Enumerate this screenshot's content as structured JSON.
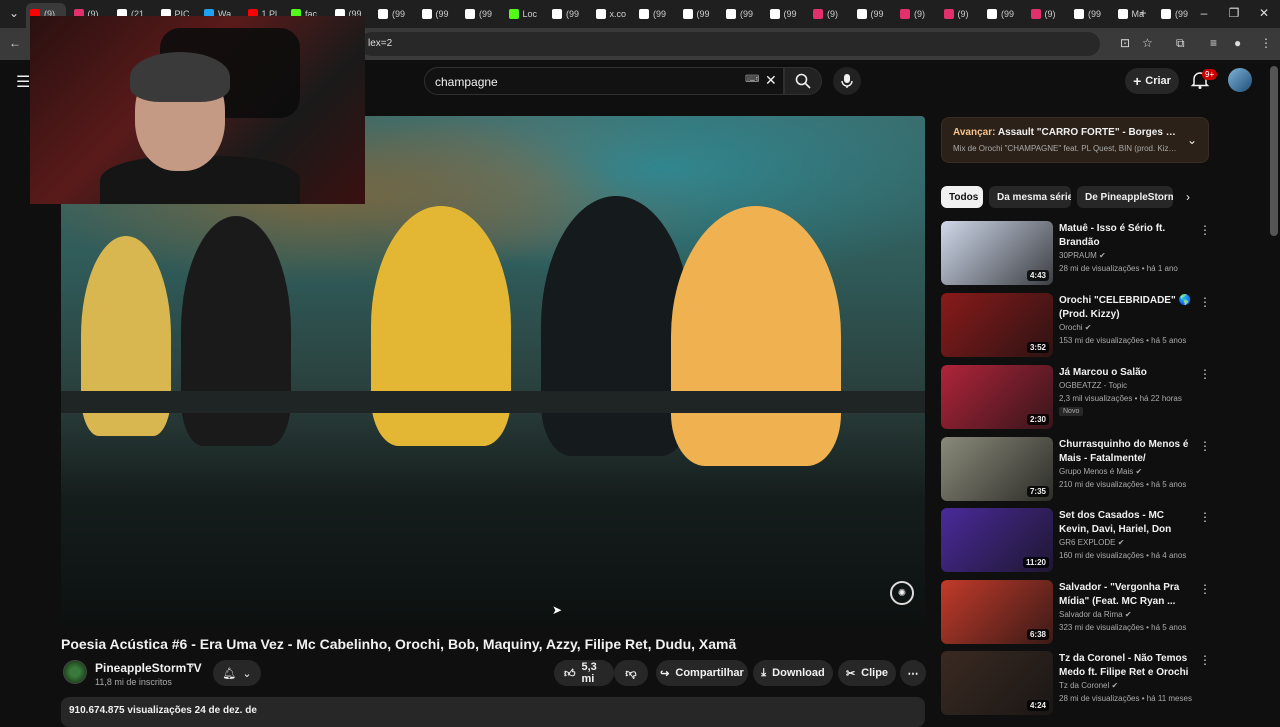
{
  "browser": {
    "tabs": [
      {
        "label": "(9)",
        "color": "#ff0000"
      },
      {
        "label": "(9)",
        "color": "#e1306c"
      },
      {
        "label": "(21",
        "color": "#ffffff"
      },
      {
        "label": "PIC",
        "color": "#ffffff"
      },
      {
        "label": "Wa",
        "color": "#1da1f2"
      },
      {
        "label": "1 Pl",
        "color": "#ff0000"
      },
      {
        "label": "fac",
        "color": "#53fc18"
      },
      {
        "label": "(99",
        "color": "#ffffff"
      },
      {
        "label": "(99",
        "color": "#ffffff"
      },
      {
        "label": "(99",
        "color": "#ffffff"
      },
      {
        "label": "(99",
        "color": "#ffffff"
      },
      {
        "label": "Loc",
        "color": "#53fc18"
      },
      {
        "label": "(99",
        "color": "#ffffff"
      },
      {
        "label": "x.co",
        "color": "#ffffff"
      },
      {
        "label": "(99",
        "color": "#ffffff"
      },
      {
        "label": "(99",
        "color": "#ffffff"
      },
      {
        "label": "(99",
        "color": "#ffffff"
      },
      {
        "label": "(99",
        "color": "#ffffff"
      },
      {
        "label": "(9)",
        "color": "#e1306c"
      },
      {
        "label": "(99",
        "color": "#ffffff"
      },
      {
        "label": "(9)",
        "color": "#e1306c"
      },
      {
        "label": "(9)",
        "color": "#e1306c"
      },
      {
        "label": "(99",
        "color": "#ffffff"
      },
      {
        "label": "(9)",
        "color": "#e1306c"
      },
      {
        "label": "(99",
        "color": "#ffffff"
      },
      {
        "label": "Ma",
        "color": "#ffffff"
      },
      {
        "label": "(99",
        "color": "#ffffff"
      }
    ],
    "new_tab": "+",
    "url_fragment": "lex=2"
  },
  "masthead": {
    "search_value": "champagne",
    "create_label": "Criar",
    "notif_badge": "9+"
  },
  "video": {
    "title": "Poesia Acústica #6 - Era Uma Vez - Mc Cabelinho, Orochi, Bob, Maquiny, Azzy, Filipe Ret, Dudu, Xamã",
    "channel": "PineappleStormTV",
    "subscribers": "11,8 mi de inscritos",
    "likes": "5,3 mi",
    "share_label": "Compartilhar",
    "download_label": "Download",
    "clip_label": "Clipe",
    "views_date": "910.674.875 visualizações  24 de dez. de"
  },
  "autoplay": {
    "next_label": "Avançar:",
    "next_title": "Assault \"CARRO FORTE\" - Borges | Orochi ...",
    "mix": "Mix de Orochi \"CHAMPAGNE\" feat. PL Quest, BIN (prod. Kizzy)"
  },
  "chips": [
    "Todos",
    "Da mesma série",
    "De PineappleStormT"
  ],
  "recommendations": [
    {
      "title": "Matuê - Isso é Sério ft. Brandão",
      "channel": "30PRAUM",
      "verified": true,
      "meta": "28 mi de visualizações • há 1 ano",
      "duration": "4:43",
      "thumb": "#cfd8ea"
    },
    {
      "title": "Orochi \"CELEBRIDADE\" 🌎 (Prod. Kizzy)",
      "channel": "Orochi",
      "verified": true,
      "meta": "153 mi de visualizações • há 5 anos",
      "duration": "3:52",
      "thumb": "#8a1a1a"
    },
    {
      "title": "Já Marcou o Salão",
      "channel": "OGBEATZZ - Topic",
      "verified": false,
      "meta": "2,3 mil visualizações • há 22 horas",
      "badge": "Novo",
      "duration": "2:30",
      "thumb": "#b0243a"
    },
    {
      "title": "Churrasquinho do Menos é Mais - Fatalmente/ Separação...",
      "channel": "Grupo Menos é Mais",
      "verified": true,
      "meta": "210 mi de visualizações • há 5 anos",
      "duration": "7:35",
      "thumb": "#8a8a7a"
    },
    {
      "title": "Set dos Casados - MC Kevin, Davi, Hariel, Don Juan, Kapela,...",
      "channel": "GR6 EXPLODE",
      "verified": true,
      "meta": "160 mi de visualizações • há 4 anos",
      "duration": "11:20",
      "thumb": "#4a2a9a"
    },
    {
      "title": "Salvador - \"Vergonha Pra Mídia\" (Feat. MC Ryan ...",
      "channel": "Salvador da Rima",
      "verified": true,
      "meta": "323 mi de visualizações • há 5 anos",
      "duration": "6:38",
      "thumb": "#c23a2a"
    },
    {
      "title": "Tz da Coronel - Não Temos Medo ft. Filipe Ret e Orochi ...",
      "channel": "Tz da Coronel",
      "verified": true,
      "meta": "28 mi de visualizações • há 11 meses",
      "duration": "4:24",
      "thumb": "#3a2a22"
    }
  ]
}
